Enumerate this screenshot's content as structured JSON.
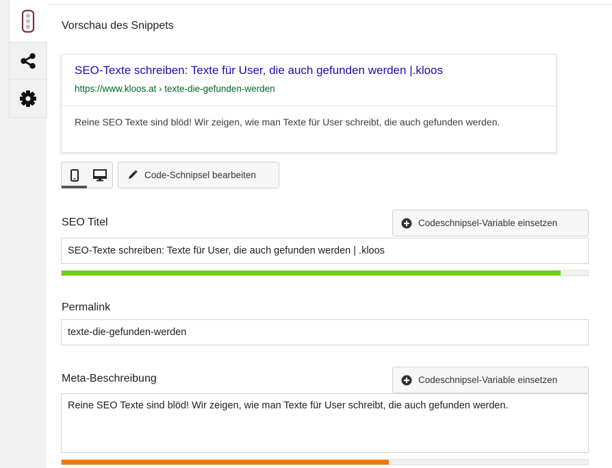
{
  "preview": {
    "heading": "Vorschau des Snippets",
    "title": "SEO-Texte schreiben: Texte für User, die auch gefunden werden |.kloos",
    "url": "https://www.kloos.at › texte-die-gefunden-werden",
    "description": "Reine SEO Texte sind blöd! Wir zeigen, wie man Texte für User schreibt, die auch gefunden werden."
  },
  "toolbar": {
    "edit_label": "Code-Schnipsel bearbeiten",
    "active_device": "mobile"
  },
  "seo_title": {
    "label": "SEO Titel",
    "variable_button": "Codeschnipsel-Variable einsetzen",
    "value": "SEO-Texte schreiben: Texte für User, die auch gefunden werden | .kloos",
    "progress": 0.948,
    "progress_color": "#6bd20a"
  },
  "permalink": {
    "label": "Permalink",
    "value": "texte-die-gefunden-werden"
  },
  "meta": {
    "label": "Meta-Beschreibung",
    "variable_button": "Codeschnipsel-Variable einsetzen",
    "value": "Reine SEO Texte sind blöd! Wir zeigen, wie man Texte für User schreibt, die auch gefunden werden.",
    "progress": 0.622,
    "progress_color": "#f0780a"
  },
  "sidebar_tabs": [
    {
      "icon": "traffic-light-icon",
      "active": true
    },
    {
      "icon": "share-icon",
      "active": false
    },
    {
      "icon": "gear-icon",
      "active": false
    }
  ],
  "colors": {
    "snippet_title": "#1a0dab",
    "snippet_url": "#006621",
    "brand_accent": "#a4286a"
  }
}
